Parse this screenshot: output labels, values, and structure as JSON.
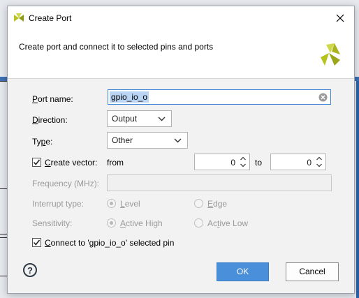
{
  "window": {
    "title": "Create Port"
  },
  "header": {
    "description": "Create port and connect it to selected pins and ports"
  },
  "form": {
    "port_name": {
      "label_u": "P",
      "label_rest": "ort name:",
      "value": "gpio_io_o"
    },
    "direction": {
      "label_u": "D",
      "label_rest": "irection:",
      "value": "Output"
    },
    "type": {
      "label_pre": "Ty",
      "label_u": "p",
      "label_rest": "e:",
      "value": "Other"
    },
    "create_vector": {
      "label_u": "C",
      "label_rest": "reate vector:",
      "checked": true,
      "from_label": "from",
      "from_value": "0",
      "to_label": "to",
      "to_value": "0"
    },
    "frequency": {
      "label": "Frequency (MHz):",
      "value": ""
    },
    "interrupt_type": {
      "label": "Interrupt type:",
      "options": {
        "level_u": "L",
        "level_rest": "evel",
        "edge_u": "E",
        "edge_rest": "dge"
      },
      "selected": "Level"
    },
    "sensitivity": {
      "label": "Sensitivity:",
      "options": {
        "high_u": "A",
        "high_rest": "ctive High",
        "low_pre": "Ac",
        "low_u": "t",
        "low_rest": "ive Low"
      },
      "selected": "Active High"
    },
    "connect": {
      "label_u": "C",
      "label_rest": "onnect to 'gpio_io_o' selected  pin",
      "checked": true
    }
  },
  "buttons": {
    "help": "?",
    "ok": "OK",
    "cancel": "Cancel"
  },
  "colors": {
    "accent": "#4a8fd9",
    "logo": "#b7c21d"
  }
}
